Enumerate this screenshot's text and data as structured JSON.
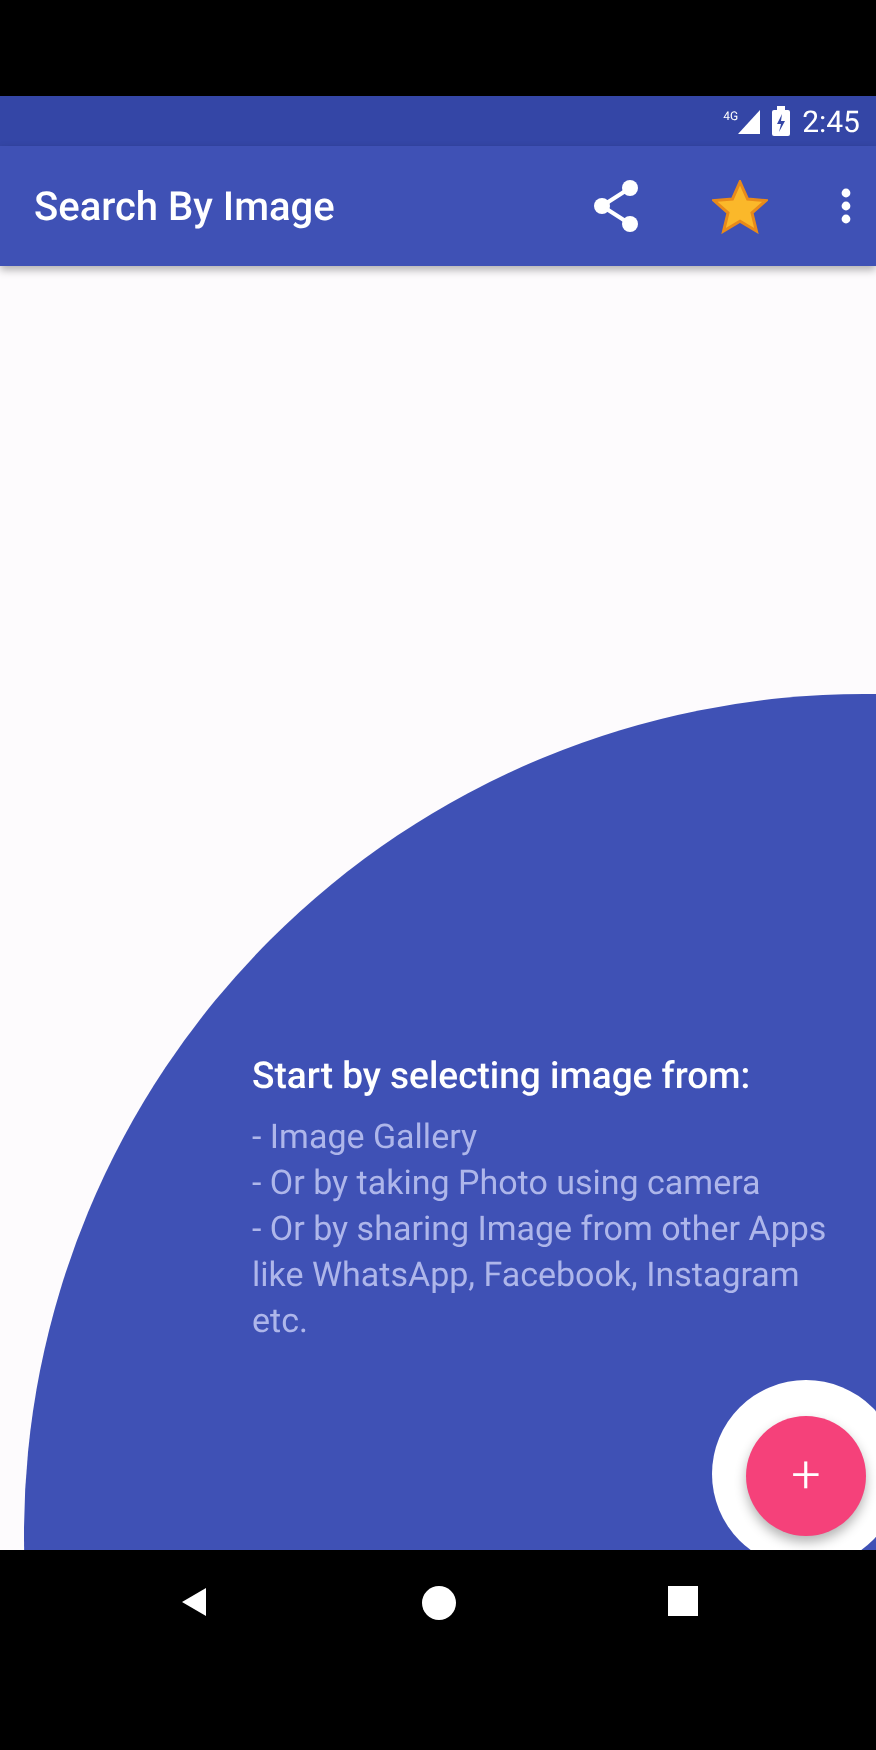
{
  "status_bar": {
    "network": "4G",
    "time": "2:45"
  },
  "app_bar": {
    "title": "Search By Image"
  },
  "empty_state": {
    "heading": "Start by selecting image from:",
    "lines": [
      "- Image Gallery",
      "- Or by taking Photo using camera",
      "- Or by sharing Image from other Apps like WhatsApp, Facebook, Instagram etc."
    ]
  },
  "fab": {
    "label": "+"
  }
}
